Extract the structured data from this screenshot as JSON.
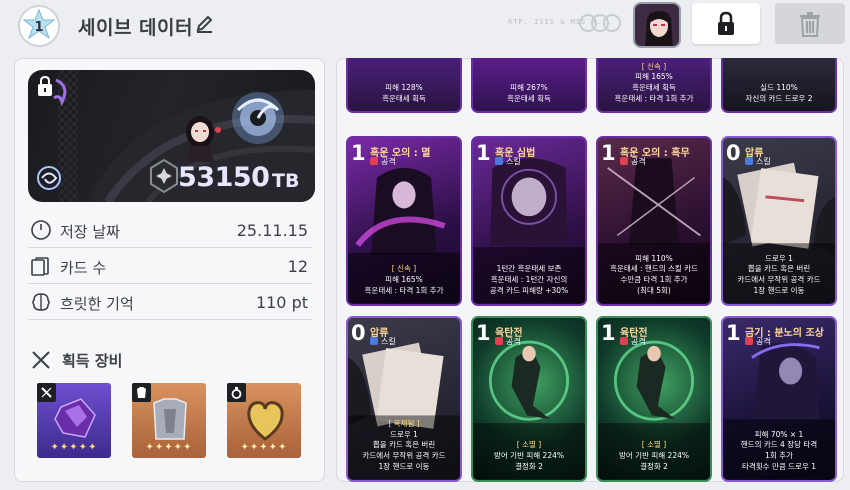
{
  "header": {
    "slot_number": "1",
    "title": "세이브 데이터",
    "watermark": "RTP. ISIS & MIS R..."
  },
  "banner": {
    "score": "53150",
    "score_unit": "TB"
  },
  "stats": [
    {
      "label": "저장 날짜",
      "value": "25.11.15",
      "icon": "clock-icon"
    },
    {
      "label": "카드 수",
      "value": "12",
      "icon": "cards-icon"
    },
    {
      "label": "흐릿한 기억",
      "value": "110 pt",
      "icon": "brain-icon"
    }
  ],
  "equipment": {
    "title": "획득 장비",
    "items": [
      {
        "tag": "sword-icon",
        "stars": "✦✦✦✦✦",
        "color": "#5b3fae"
      },
      {
        "tag": "armor-icon",
        "stars": "✦✦✦✦✦",
        "color": "#b8744a"
      },
      {
        "tag": "ring-icon",
        "stars": "✦✦✦✦✦",
        "color": "#b8744a"
      }
    ]
  },
  "cards_top": [
    {
      "lines": [
        "피해 128%",
        "흑운태세 획득"
      ],
      "nums": []
    },
    {
      "lines": [
        "피해 267%",
        "흑운태세 획득"
      ]
    },
    {
      "kw": "[ 신속 ]",
      "lines": [
        "피해 165%",
        "흑운태세 획득",
        "흑운태세 : 타격 1회 추가"
      ]
    },
    {
      "lines": [
        "실드 110%",
        "자신의 카드 드로우 2"
      ]
    }
  ],
  "cards_mid": [
    {
      "cost": "1",
      "name": "흑운 오의 : 멸",
      "type": "공격",
      "kw": "[ 신속 ]",
      "lines": [
        "피해 165%",
        "흑운태세 : 타격 1회 추가"
      ]
    },
    {
      "cost": "1",
      "name": "흑운 심법",
      "type": "스킬",
      "lines": [
        "1턴간 흑운태세 보존",
        "흑운태세 : 1턴간 자신의",
        "공격 카드 피해량 +30%"
      ]
    },
    {
      "cost": "1",
      "name": "흑운 오의 : 흑무",
      "type": "공격",
      "lines": [
        "피해 110%",
        "흑운태세 : 핸드의 스킬 카드",
        "수만큼 타격 1회 추가",
        "(최대 5회)"
      ]
    },
    {
      "cost": "0",
      "name": "압류",
      "type": "스킬",
      "lines": [
        "드로우 1",
        "뽑을 카드 혹은 버린",
        "카드에서 무작위 공격 카드",
        "1장 핸드로 이동"
      ]
    }
  ],
  "cards_bottom": [
    {
      "cost": "0",
      "name": "압류",
      "type": "스킬",
      "kw": "[ 복제됨 ]",
      "lines": [
        "드로우 1",
        "뽑을 카드 혹은 버린",
        "카드에서 무작위 공격 카드",
        "1장 핸드로 이동"
      ]
    },
    {
      "cost": "1",
      "name": "육탄전",
      "type": "공격",
      "kw": "[ 소멸 ]",
      "lines": [
        "방어 기반 피해 224%",
        "결정화 2"
      ]
    },
    {
      "cost": "1",
      "name": "육탄전",
      "type": "공격",
      "kw": "[ 소멸 ]",
      "lines": [
        "방어 기반 피해 224%",
        "결정화 2"
      ]
    },
    {
      "cost": "1",
      "name": "금기 : 분노의 조상",
      "type": "공격",
      "lines": [
        "피해 70% × 1",
        "핸드의 카드 4 장당 타격",
        "1회 추가",
        "타격횟수 만큼 드로우 1"
      ]
    }
  ]
}
